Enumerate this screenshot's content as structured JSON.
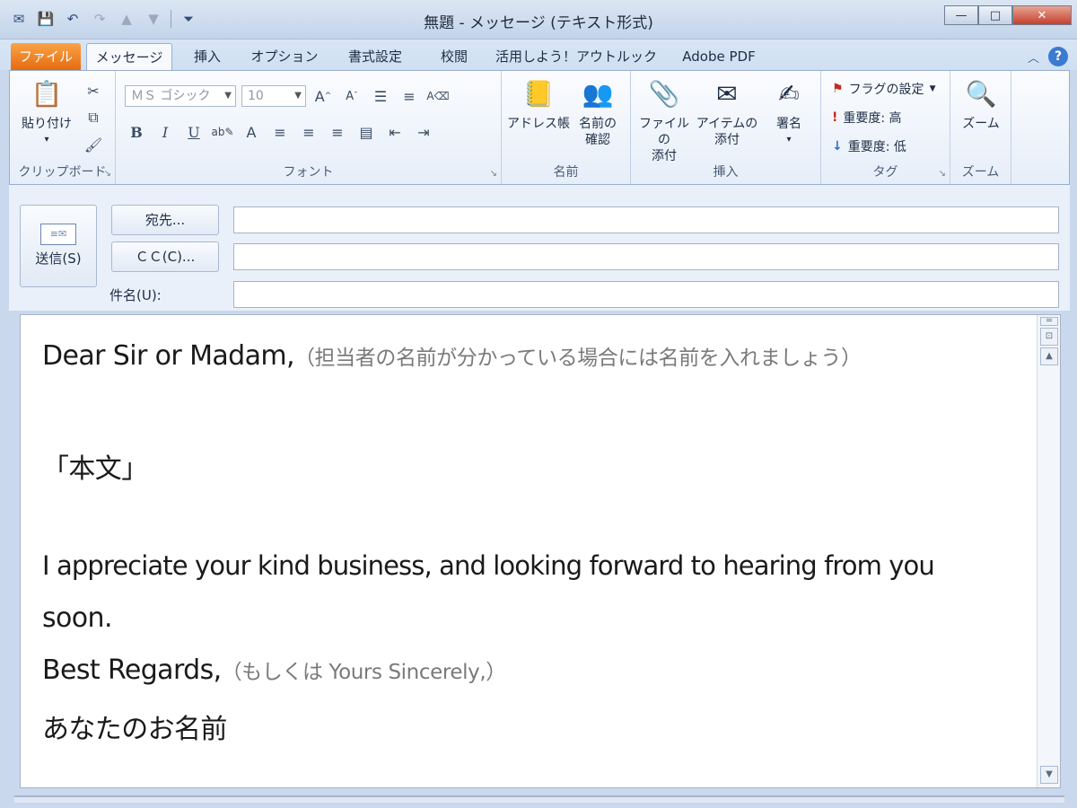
{
  "window": {
    "title": "無題 - メッセージ (テキスト形式)",
    "controls": {
      "minimize": "—",
      "maximize": "□",
      "close": "✕"
    }
  },
  "tabs": {
    "file": "ファイル",
    "message": "メッセージ",
    "insert": "挿入",
    "options": "オプション",
    "format": "書式設定",
    "review": "校閲",
    "outlook": "活用しよう！アウトルック",
    "pdf": "Adobe PDF"
  },
  "ribbon": {
    "clipboard": {
      "paste": "貼り付け",
      "label": "クリップボード"
    },
    "font": {
      "font_name": "ＭＳ ゴシック",
      "font_size": "10",
      "label": "フォント"
    },
    "names": {
      "address_book": "アドレス帳",
      "check_names_1": "名前の",
      "check_names_2": "確認",
      "label": "名前"
    },
    "include": {
      "attach_file_1": "ファイルの",
      "attach_file_2": "添付",
      "attach_item_1": "アイテムの",
      "attach_item_2": "添付",
      "signature": "署名",
      "label": "挿入"
    },
    "tags": {
      "flag": "フラグの設定",
      "high": "重要度: 高",
      "low": "重要度: 低",
      "label": "タグ"
    },
    "zoom": {
      "zoom": "ズーム",
      "label": "ズーム"
    }
  },
  "compose": {
    "send": "送信(S)",
    "to": "宛先...",
    "cc": "ＣＣ(C)...",
    "subject_label": "件名(U):",
    "to_value": "",
    "cc_value": "",
    "subject_value": ""
  },
  "body": {
    "greeting": "Dear Sir or Madam,",
    "greeting_note": "（担当者の名前が分かっている場合には名前を入れましょう）",
    "main": "「本文」",
    "closing_line_1": "I appreciate your kind business, and looking forward to hearing from you",
    "closing_line_2": "soon.",
    "regards": "Best Regards,",
    "regards_note": "（もしくは Yours Sincerely,）",
    "signature": "あなたのお名前"
  }
}
